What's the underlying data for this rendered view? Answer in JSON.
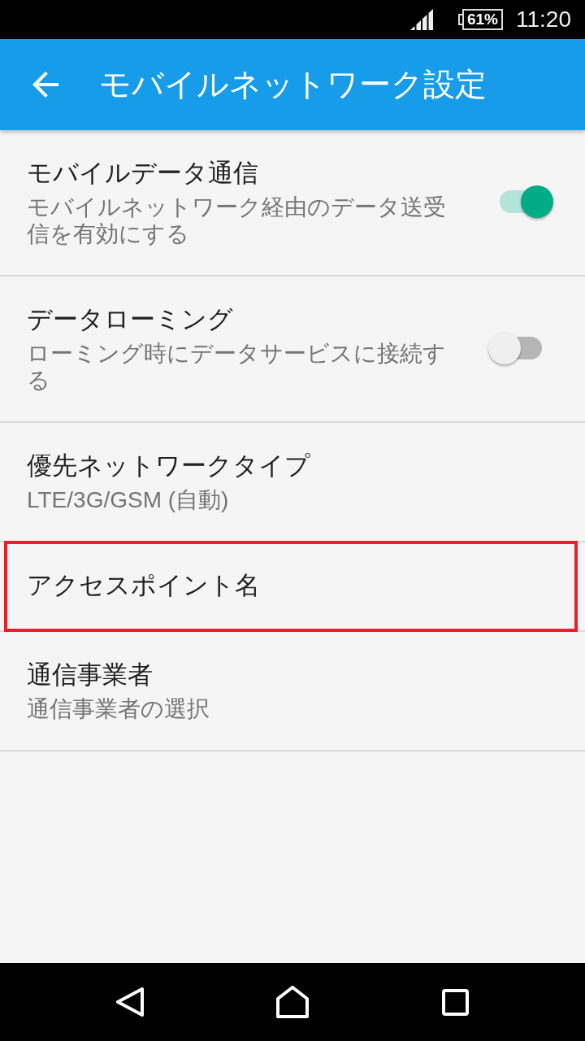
{
  "status_bar": {
    "battery": "61%",
    "time": "11:20"
  },
  "app_bar": {
    "title": "モバイルネットワーク設定"
  },
  "items": [
    {
      "kind": "switch",
      "title": "モバイルデータ通信",
      "summary": "モバイルネットワーク経由のデータ送受信を有効にする",
      "on": true,
      "highlighted": false
    },
    {
      "kind": "switch",
      "title": "データローミング",
      "summary": "ローミング時にデータサービスに接続する",
      "on": false,
      "highlighted": false
    },
    {
      "kind": "plain",
      "title": "優先ネットワークタイプ",
      "summary": "LTE/3G/GSM (自動)",
      "highlighted": false
    },
    {
      "kind": "plain",
      "title": "アクセスポイント名",
      "highlighted": true
    },
    {
      "kind": "plain",
      "title": "通信事業者",
      "summary": "通信事業者の選択",
      "highlighted": false
    }
  ]
}
